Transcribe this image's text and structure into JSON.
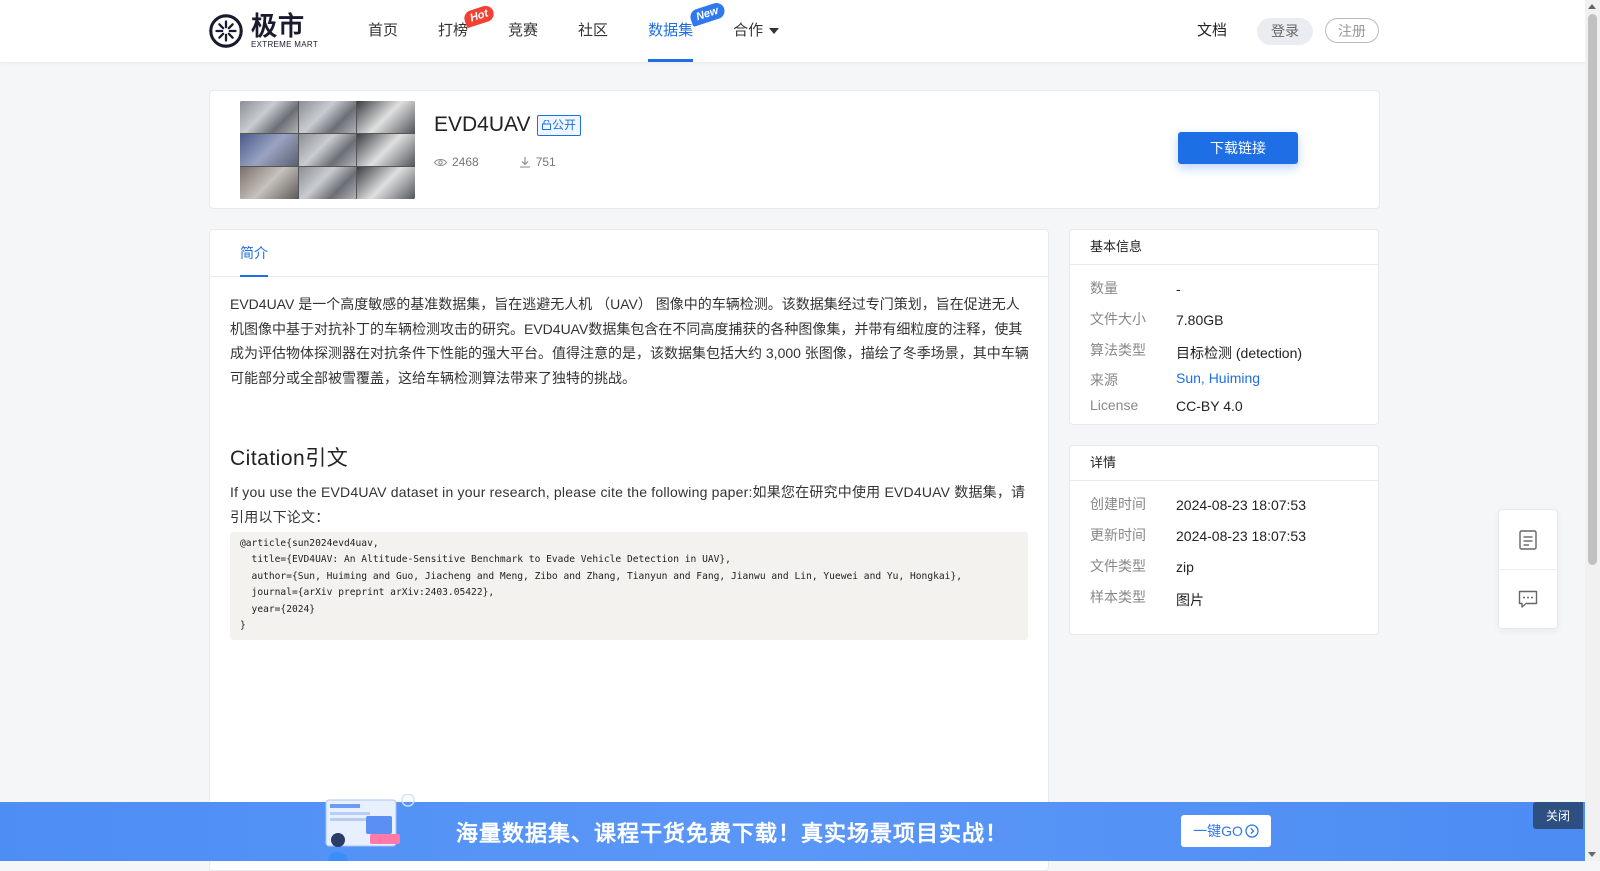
{
  "header": {
    "logo_cn": "极市",
    "logo_en": "EXTREME MART",
    "nav": [
      {
        "label": "首页"
      },
      {
        "label": "打榜",
        "badge": "Hot"
      },
      {
        "label": "竞赛"
      },
      {
        "label": "社区"
      },
      {
        "label": "数据集",
        "badge": "New"
      },
      {
        "label": "合作"
      }
    ],
    "docs": "文档",
    "login": "登录",
    "register": "注册"
  },
  "dataset": {
    "title": "EVD4UAV",
    "tag": "公开",
    "views": "2468",
    "downloads": "751",
    "download_button": "下载链接"
  },
  "main": {
    "tab": "简介",
    "intro": "EVD4UAV 是一个高度敏感的基准数据集，旨在逃避无人机 （UAV） 图像中的车辆检测。该数据集经过专门策划，旨在促进无人机图像中基于对抗补丁的车辆检测攻击的研究。EVD4UAV数据集包含在不同高度捕获的各种图像集，并带有细粒度的注释，使其成为评估物体探测器在对抗条件下性能的强大平台。值得注意的是，该数据集包括大约 3,000 张图像，描绘了冬季场景，其中车辆可能部分或全部被雪覆盖，这给车辆检测算法带来了独特的挑战。",
    "citation_heading": "Citation引文",
    "citation_text": "If you use the EVD4UAV dataset in your research, please cite the following paper:如果您在研究中使用 EVD4UAV 数据集，请引用以下论文：",
    "bibtex": "@article{sun2024evd4uav,\n  title={EVD4UAV: An Altitude-Sensitive Benchmark to Evade Vehicle Detection in UAV},\n  author={Sun, Huiming and Guo, Jiacheng and Meng, Zibo and Zhang, Tianyun and Fang, Jianwu and Lin, Yuewei and Yu, Hongkai},\n  journal={arXiv preprint arXiv:2403.05422},\n  year={2024}\n}"
  },
  "basic_info": {
    "title": "基本信息",
    "rows": [
      {
        "label": "数量",
        "value": "-"
      },
      {
        "label": "文件大小",
        "value": "7.80GB"
      },
      {
        "label": "算法类型",
        "value": "目标检测 (detection)"
      },
      {
        "label": "来源",
        "value": "Sun, Huiming"
      },
      {
        "label": "License",
        "value": "CC-BY 4.0"
      }
    ]
  },
  "details": {
    "title": "详情",
    "rows": [
      {
        "label": "创建时间",
        "value": "2024-08-23 18:07:53"
      },
      {
        "label": "更新时间",
        "value": "2024-08-23 18:07:53"
      },
      {
        "label": "文件类型",
        "value": "zip"
      },
      {
        "label": "样本类型",
        "value": "图片"
      }
    ]
  },
  "banner": {
    "text": "海量数据集、课程干货免费下载！真实场景项目实战！",
    "go_button": "一键GO",
    "close": "关闭"
  },
  "colors": {
    "accent": "#1e6fe5",
    "hot_badge": "#f04134",
    "new_badge": "#2e78f0",
    "banner": "#5b97f7"
  },
  "icons": {
    "views": "eye-icon",
    "downloads": "download-icon",
    "float_1": "document-icon",
    "float_2": "chat-icon",
    "go": "arrow-circle-icon"
  }
}
